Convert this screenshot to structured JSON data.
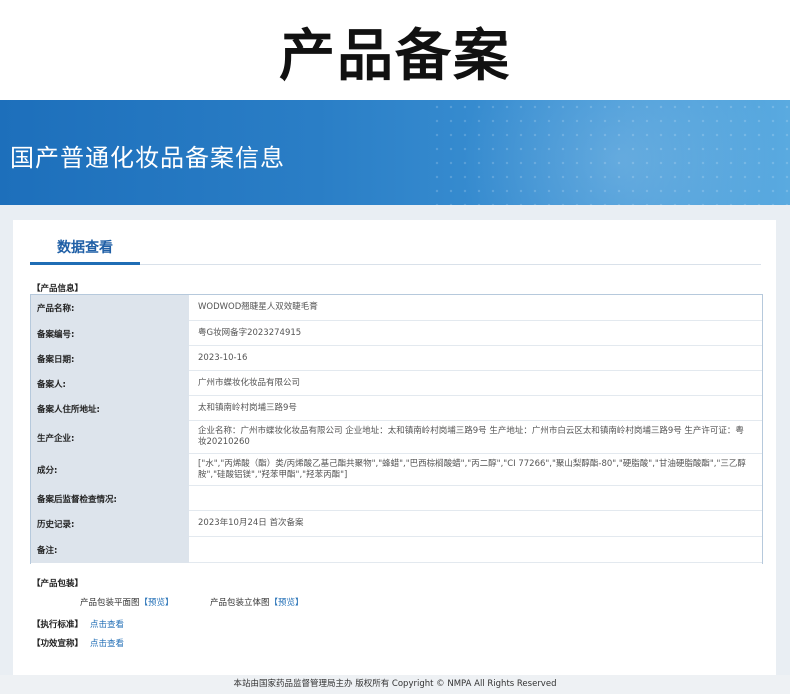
{
  "page_title": "产品备案",
  "banner_title": "国产普通化妆品备案信息",
  "tab_label": "数据查看",
  "sections": {
    "product_info": "【产品信息】",
    "product_package": "【产品包装】",
    "standard": "【执行标准】",
    "efficacy": "【功效宣称】"
  },
  "rows": [
    {
      "key": "产品名称:",
      "value": "WODWOD翘睫星人双效睫毛膏"
    },
    {
      "key": "备案编号:",
      "value": "粤G妆网备字2023274915"
    },
    {
      "key": "备案日期:",
      "value": "2023-10-16"
    },
    {
      "key": "备案人:",
      "value": "广州市蝶妆化妆品有限公司"
    },
    {
      "key": "备案人住所地址:",
      "value": "太和镇南岭村岗埔三路9号"
    },
    {
      "key": "生产企业:",
      "value": "企业名称：广州市蝶妆化妆品有限公司 企业地址：太和镇南岭村岗埔三路9号 生产地址：广州市白云区太和镇南岭村岗埔三路9号 生产许可证：粤妆20210260"
    },
    {
      "key": "成分:",
      "value": "[\"水\",\"丙烯酸（酯）类/丙烯酸乙基己酯共聚物\",\"蜂蜡\",\"巴西棕榈酸蜡\",\"丙二醇\",\"CI 77266\",\"聚山梨醇酯-80\",\"硬脂酸\",\"甘油硬脂酸酯\",\"三乙醇胺\",\"硅酸铝镁\",\"羟苯甲酯\",\"羟苯丙酯\"]"
    },
    {
      "key": "备案后监督检查情况:",
      "value": ""
    },
    {
      "key": "历史记录:",
      "value": "2023年10月24日  首次备案"
    },
    {
      "key": "备注:",
      "value": ""
    }
  ],
  "package": {
    "flat_label": "产品包装平面图",
    "flat_link": "【预览】",
    "solid_label": "产品包装立体图",
    "solid_link": "【预览】"
  },
  "view_link": "点击查看",
  "footer": "本站由国家药品监督管理局主办 版权所有 Copyright © NMPA All Rights Reserved"
}
